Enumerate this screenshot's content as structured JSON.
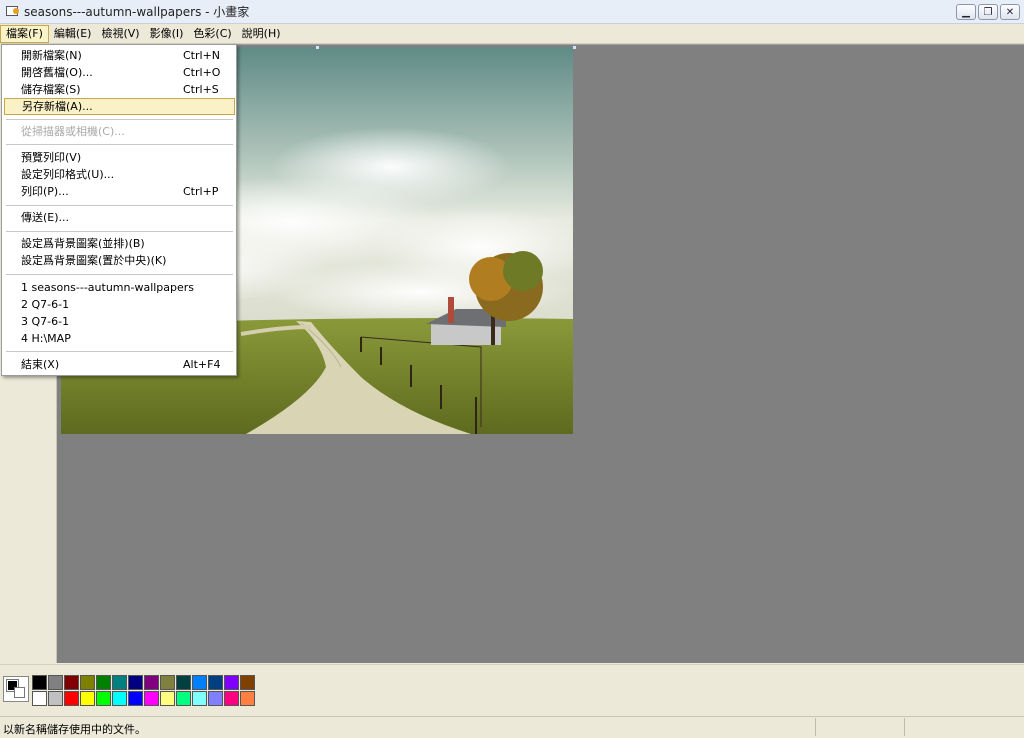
{
  "window": {
    "title": "seasons---autumn-wallpapers - 小畫家",
    "controls": [
      "minimize",
      "restore",
      "close"
    ]
  },
  "menubar": [
    {
      "label": "檔案(F)",
      "active": true
    },
    {
      "label": "編輯(E)"
    },
    {
      "label": "檢視(V)"
    },
    {
      "label": "影像(I)"
    },
    {
      "label": "色彩(C)"
    },
    {
      "label": "說明(H)"
    }
  ],
  "file_menu": {
    "items": [
      {
        "label": "開新檔案(N)",
        "shortcut": "Ctrl+N"
      },
      {
        "label": "開啓舊檔(O)...",
        "shortcut": "Ctrl+O"
      },
      {
        "label": "儲存檔案(S)",
        "shortcut": "Ctrl+S"
      },
      {
        "label": "另存新檔(A)...",
        "shortcut": "",
        "highlighted": true
      },
      {
        "label": "從掃描器或相機(C)...",
        "shortcut": "",
        "disabled": true
      },
      {
        "label": "預覽列印(V)",
        "shortcut": ""
      },
      {
        "label": "設定列印格式(U)...",
        "shortcut": ""
      },
      {
        "label": "列印(P)...",
        "shortcut": "Ctrl+P"
      },
      {
        "label": "傳送(E)...",
        "shortcut": ""
      },
      {
        "label": "設定爲背景圖案(並排)(B)",
        "shortcut": ""
      },
      {
        "label": "設定爲背景圖案(置於中央)(K)",
        "shortcut": ""
      },
      {
        "label": "1 seasons---autumn-wallpapers",
        "shortcut": ""
      },
      {
        "label": "2 Q7-6-1",
        "shortcut": ""
      },
      {
        "label": "3 Q7-6-1",
        "shortcut": ""
      },
      {
        "label": "4 H:\\MAP",
        "shortcut": ""
      },
      {
        "label": "結束(X)",
        "shortcut": "Alt+F4"
      }
    ]
  },
  "palette": {
    "current_foreground": "#000000",
    "current_background": "#ffffff",
    "row1": [
      "#000000",
      "#808080",
      "#800000",
      "#808000",
      "#008000",
      "#008080",
      "#000080",
      "#800080",
      "#808040",
      "#004040",
      "#0080ff",
      "#004080",
      "#8000ff",
      "#804000"
    ],
    "row2": [
      "#ffffff",
      "#c0c0c0",
      "#ff0000",
      "#ffff00",
      "#00ff00",
      "#00ffff",
      "#0000ff",
      "#ff00ff",
      "#ffff80",
      "#00ff80",
      "#80ffff",
      "#8080ff",
      "#ff0080",
      "#ff8040"
    ]
  },
  "status": {
    "text": "以新名稱儲存使用中的文件。"
  }
}
